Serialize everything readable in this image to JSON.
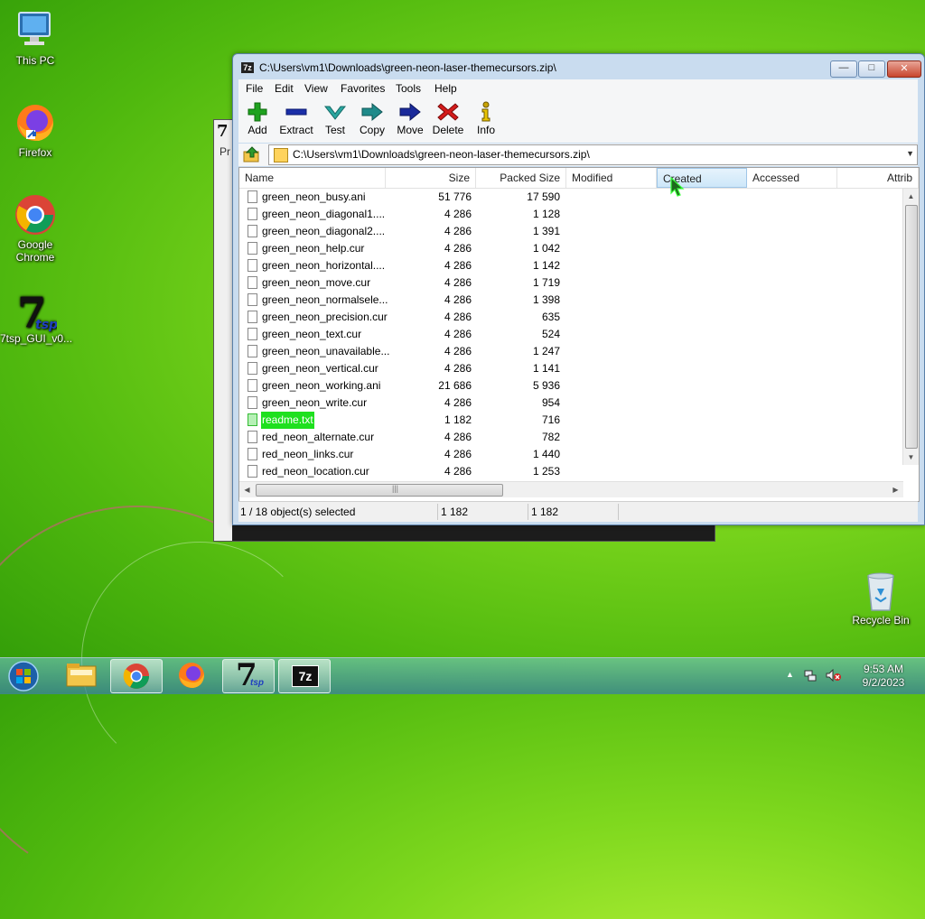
{
  "desktop": {
    "icons": [
      {
        "name": "this-pc",
        "label": "This PC"
      },
      {
        "name": "firefox",
        "label": "Firefox"
      },
      {
        "name": "google-chrome",
        "label": "Google Chrome"
      },
      {
        "name": "7tsp",
        "label": "7tsp_GUI_v0..."
      },
      {
        "name": "recycle-bin",
        "label": "Recycle Bin"
      }
    ]
  },
  "background_window": {
    "icon_text": "7",
    "label": "Pr"
  },
  "window": {
    "title": "C:\\Users\\vm1\\Downloads\\green-neon-laser-themecursors.zip\\",
    "icon_text": "7z",
    "caption": {
      "minimize": "—",
      "maximize": "□",
      "close": "✕"
    },
    "menu": [
      "File",
      "Edit",
      "View",
      "Favorites",
      "Tools",
      "Help"
    ],
    "toolbar": [
      {
        "label": "Add",
        "icon": "plus-icon",
        "color": "#1fa21f"
      },
      {
        "label": "Extract",
        "icon": "minus-icon",
        "color": "#1a2fa8"
      },
      {
        "label": "Test",
        "icon": "check-icon",
        "color": "#2aa6a0"
      },
      {
        "label": "Copy",
        "icon": "copy-arrow-icon",
        "color": "#1f8a8a"
      },
      {
        "label": "Move",
        "icon": "move-arrow-icon",
        "color": "#1a2a9a"
      },
      {
        "label": "Delete",
        "icon": "delete-x-icon",
        "color": "#d41b1b"
      },
      {
        "label": "Info",
        "icon": "info-icon",
        "color": "#c9a400"
      }
    ],
    "address": "C:\\Users\\vm1\\Downloads\\green-neon-laser-themecursors.zip\\",
    "columns": [
      "Name",
      "Size",
      "Packed Size",
      "Modified",
      "Created",
      "Accessed",
      "Attrib"
    ],
    "files": [
      {
        "name": "green_neon_busy.ani",
        "size": "51 776",
        "packed": "17 590"
      },
      {
        "name": "green_neon_diagonal1....",
        "size": "4 286",
        "packed": "1 128"
      },
      {
        "name": "green_neon_diagonal2....",
        "size": "4 286",
        "packed": "1 391"
      },
      {
        "name": "green_neon_help.cur",
        "size": "4 286",
        "packed": "1 042"
      },
      {
        "name": "green_neon_horizontal....",
        "size": "4 286",
        "packed": "1 142"
      },
      {
        "name": "green_neon_move.cur",
        "size": "4 286",
        "packed": "1 719"
      },
      {
        "name": "green_neon_normalsele...",
        "size": "4 286",
        "packed": "1 398"
      },
      {
        "name": "green_neon_precision.cur",
        "size": "4 286",
        "packed": "635"
      },
      {
        "name": "green_neon_text.cur",
        "size": "4 286",
        "packed": "524"
      },
      {
        "name": "green_neon_unavailable...",
        "size": "4 286",
        "packed": "1 247"
      },
      {
        "name": "green_neon_vertical.cur",
        "size": "4 286",
        "packed": "1 141"
      },
      {
        "name": "green_neon_working.ani",
        "size": "21 686",
        "packed": "5 936"
      },
      {
        "name": "green_neon_write.cur",
        "size": "4 286",
        "packed": "954"
      },
      {
        "name": "readme.txt",
        "size": "1 182",
        "packed": "716",
        "selected": true
      },
      {
        "name": "red_neon_alternate.cur",
        "size": "4 286",
        "packed": "782"
      },
      {
        "name": "red_neon_links.cur",
        "size": "4 286",
        "packed": "1 440"
      },
      {
        "name": "red_neon_location.cur",
        "size": "4 286",
        "packed": "1 253"
      }
    ],
    "status": {
      "selection": "1 / 18 object(s) selected",
      "size": "1 182",
      "packed": "1 182"
    }
  },
  "taskbar": {
    "clock_time": "9:53 AM",
    "clock_date": "9/2/2023",
    "tb_7tsp_text": "7",
    "tb_7z_text": "7z"
  }
}
